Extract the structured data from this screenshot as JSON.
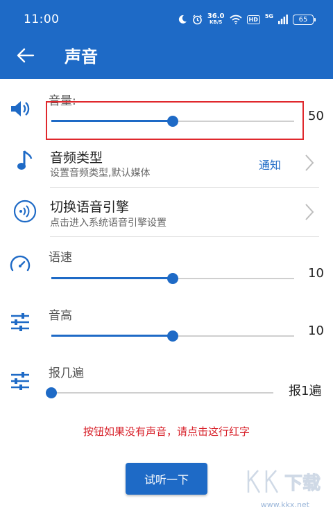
{
  "status_bar": {
    "time": "11:00",
    "net_speed": "36.0",
    "net_unit": "KB/S",
    "hd": "HD",
    "net_type": "5G",
    "battery": "65"
  },
  "header": {
    "title": "声音",
    "background_color": "#1e6ac6"
  },
  "volume": {
    "label": "音量:",
    "value": "50",
    "level": 0.5
  },
  "audio_type": {
    "title": "音频类型",
    "subtitle": "设置音频类型,默认媒体",
    "value": "通知"
  },
  "engine": {
    "title": "切换语音引擎",
    "subtitle": "点击进入系统语音引擎设置"
  },
  "speed": {
    "label": "语速",
    "value": "10",
    "level": 0.5
  },
  "pitch": {
    "label": "音高",
    "value": "10",
    "level": 0.5
  },
  "repeat": {
    "label": "报几遍",
    "value": "报1遍",
    "level": 0.0
  },
  "warning_text": "按钮如果没有声音，请点击这行红字",
  "test_button": "试听一下",
  "watermark": {
    "brand": "KK下载",
    "url": "www.kkx.net"
  },
  "colors": {
    "accent": "#1e6ac6",
    "warning": "#d8222b",
    "highlight_box": "#e0282d"
  },
  "icons": [
    "volume-icon",
    "music-note-icon",
    "voice-engine-icon",
    "speedometer-icon",
    "equalizer-icon",
    "chevron-right-icon",
    "back-arrow-icon"
  ]
}
